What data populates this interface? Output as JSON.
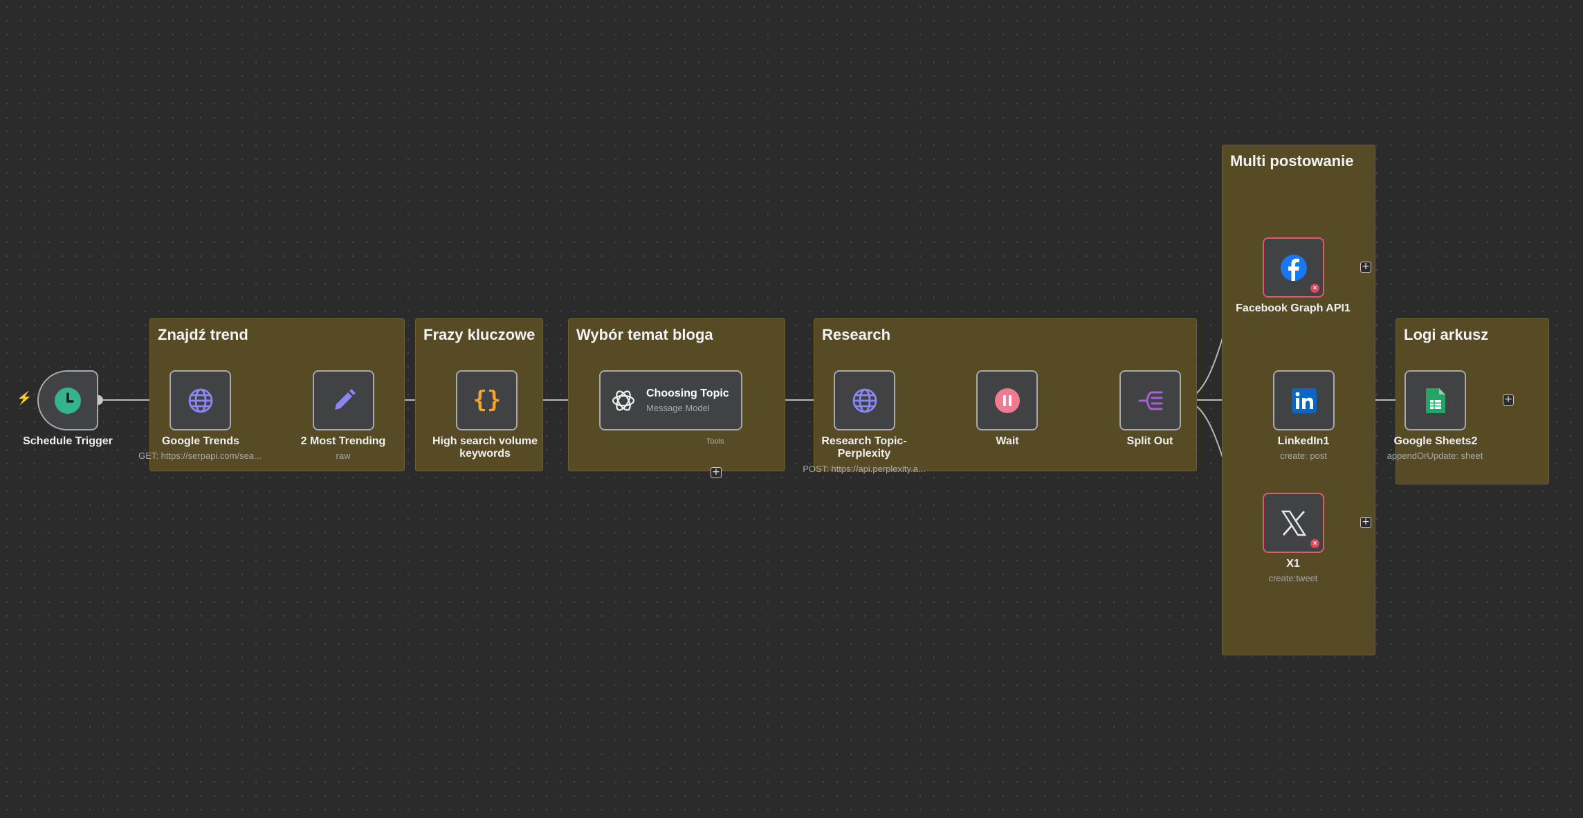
{
  "groups": {
    "trend": "Znajdź trend",
    "keywords": "Frazy kluczowe",
    "topic": "Wybór temat bloga",
    "research": "Research",
    "multi": "Multi postowanie",
    "logs": "Logi arkusz"
  },
  "nodes": {
    "schedule_trigger": {
      "label": "Schedule Trigger",
      "icon": "clock-icon"
    },
    "google_trends": {
      "label": "Google Trends",
      "sub": "GET: https://serpapi.com/sea...",
      "icon": "globe-icon"
    },
    "most_trending": {
      "label": "2 Most Trending",
      "sub": "raw",
      "icon": "pencil-icon"
    },
    "high_search": {
      "label": "High search volume keywords",
      "icon": "braces-icon"
    },
    "choosing_topic": {
      "label": "Choosing Topic",
      "sub": "Message Model",
      "icon": "openai-icon",
      "tools_label": "Tools"
    },
    "research_perplexity": {
      "label": "Research Topic- Perplexity",
      "sub": "POST: https://api.perplexity.a...",
      "icon": "globe-icon"
    },
    "wait": {
      "label": "Wait",
      "icon": "pause-icon"
    },
    "split_out": {
      "label": "Split Out",
      "icon": "split-icon"
    },
    "facebook": {
      "label": "Facebook Graph API1",
      "icon": "facebook-icon"
    },
    "linkedin": {
      "label": "LinkedIn1",
      "sub": "create: post",
      "icon": "linkedin-icon"
    },
    "x": {
      "label": "X1",
      "sub": "create:tweet",
      "icon": "x-icon"
    },
    "sheets": {
      "label": "Google Sheets2",
      "sub": "appendOrUpdate: sheet",
      "icon": "sheets-icon"
    }
  },
  "colors": {
    "canvas": "#2b2b2b",
    "group": "#574b26",
    "node": "#414244",
    "node_border": "#a8a8ad",
    "error": "#e05a6a",
    "trigger_icon": "#35b48c",
    "globe_icon": "#8b86f5",
    "braces_icon": "#f5a233",
    "wait_icon": "#f07a8f",
    "split_icon": "#a85fd8",
    "facebook": "#1877f2",
    "linkedin": "#0a66c2",
    "sheets": "#23a566"
  }
}
